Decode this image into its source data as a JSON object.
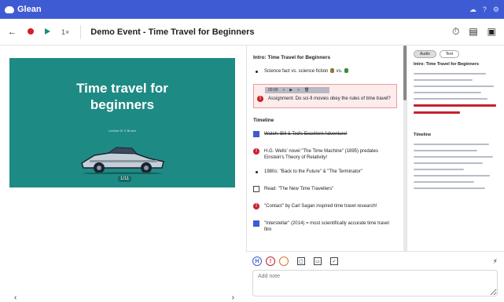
{
  "app": {
    "name": "Glean"
  },
  "toolbar": {
    "back_icon": "back-arrow-icon",
    "speed_label": "1×",
    "title": "Demo Event - Time Travel for Beginners"
  },
  "slide": {
    "title_line1": "Time travel for",
    "title_line2": "beginners",
    "subtitle": "Lecture Dr X Brown",
    "page_indicator": "1/11",
    "background_color": "#1e8a84"
  },
  "notes": {
    "section1_heading": "Intro: Time Travel for Beginners",
    "item1_text": "Science fact vs. science fiction",
    "item1_vs": "vs.",
    "audio_time": "00:00",
    "assignment_text": "Assignment: Do sci-fi movies obey the rules of time travel?",
    "section2_heading": "Timeline",
    "timeline": [
      {
        "type": "check-done",
        "text": "Watch: Bill & Ted's Excellent Adventure!"
      },
      {
        "type": "alert",
        "text": "H.G. Wells' novel \"The Time Machine\" (1895) predates Einstein's Theory of Relativity!"
      },
      {
        "type": "bullet",
        "text": "1980s: \"Back to the Future\" & \"The Terminator\""
      },
      {
        "type": "check",
        "text": "Read: \"The New Time Travellers\""
      },
      {
        "type": "alert",
        "text": "\"Contact\" by Carl Sagan inspired time travel research!"
      },
      {
        "type": "check-done",
        "text": "\"Interstellar\" (2014) = most scientifically accurate time travel film"
      }
    ]
  },
  "right_panel": {
    "pill_audio": "Audio",
    "pill_text": "Text",
    "heading": "Intro: Time Travel for Beginners",
    "timeline_heading": "Timeline"
  },
  "composer": {
    "placeholder": "Add note",
    "btn_h": "H",
    "btn_alert": "!"
  }
}
